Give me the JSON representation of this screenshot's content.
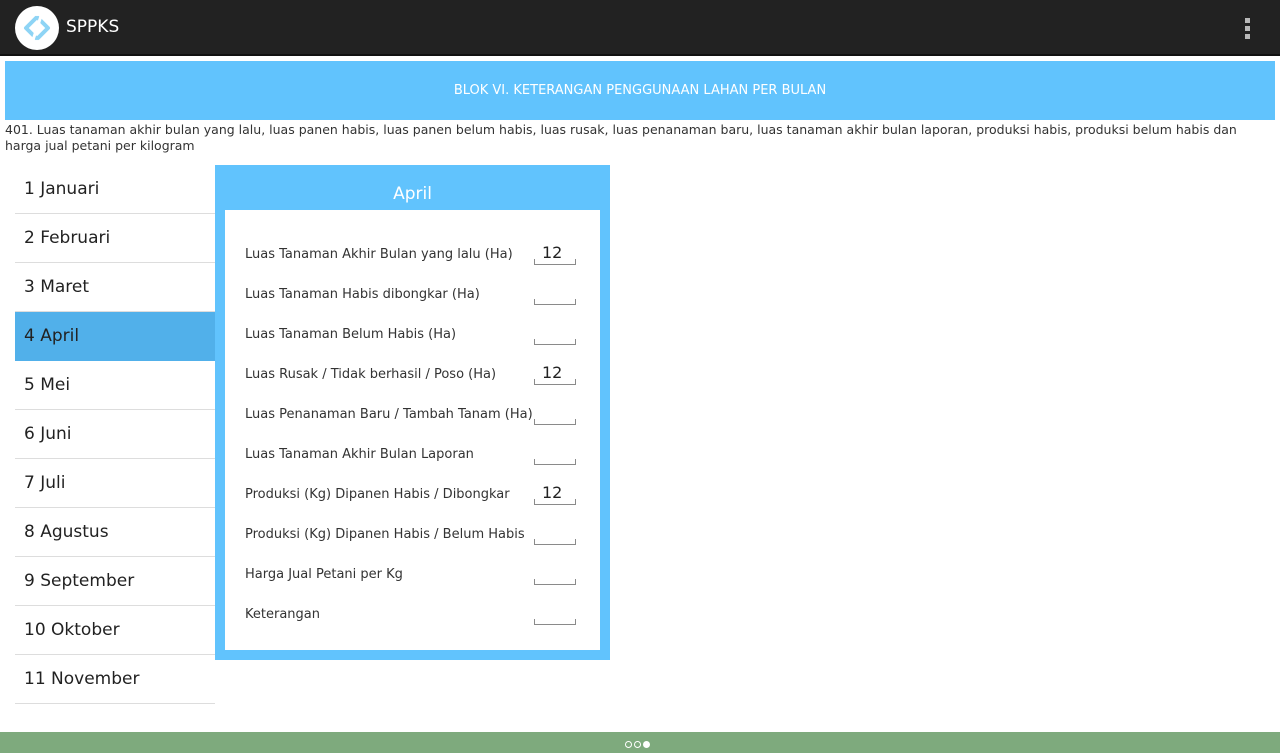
{
  "app": {
    "title": "SPPKS"
  },
  "block": {
    "title": "BLOK VI. KETERANGAN PENGGUNAAN LAHAN PER BULAN",
    "question": "401. Luas tanaman akhir bulan yang lalu, luas panen habis, luas panen belum habis, luas rusak, luas penanaman baru, luas tanaman akhir bulan laporan, produksi habis, produksi belum habis dan harga jual petani per kilogram"
  },
  "months": [
    {
      "label": "1 Januari",
      "selected": false
    },
    {
      "label": "2 Februari",
      "selected": false
    },
    {
      "label": "3 Maret",
      "selected": false
    },
    {
      "label": "4 April",
      "selected": true
    },
    {
      "label": "5 Mei",
      "selected": false
    },
    {
      "label": "6 Juni",
      "selected": false
    },
    {
      "label": "7 Juli",
      "selected": false
    },
    {
      "label": "8 Agustus",
      "selected": false
    },
    {
      "label": "9 September",
      "selected": false
    },
    {
      "label": "10 Oktober",
      "selected": false
    },
    {
      "label": "11 November",
      "selected": false
    }
  ],
  "card": {
    "title": "April",
    "fields": [
      {
        "label": "Luas Tanaman  Akhir Bulan yang lalu (Ha)",
        "value": "12"
      },
      {
        "label": "Luas Tanaman  Habis dibongkar (Ha)",
        "value": ""
      },
      {
        "label": "Luas Tanaman  Belum Habis (Ha)",
        "value": ""
      },
      {
        "label": "Luas Rusak / Tidak berhasil / Poso (Ha)",
        "value": "12"
      },
      {
        "label": "Luas Penanaman Baru / Tambah Tanam (Ha)",
        "value": ""
      },
      {
        "label": "Luas Tanaman Akhir Bulan Laporan",
        "value": ""
      },
      {
        "label": "Produksi (Kg) Dipanen Habis / Dibongkar",
        "value": "12"
      },
      {
        "label": "Produksi (Kg) Dipanen Habis / Belum Habis",
        "value": ""
      },
      {
        "label": "Harga Jual Petani per Kg",
        "value": ""
      },
      {
        "label": "Keterangan",
        "value": ""
      }
    ]
  },
  "pager": {
    "total": 3,
    "active": 3
  },
  "colors": {
    "actionbar": "#222222",
    "accent": "#61c3fd",
    "selected": "#51b0ea",
    "bottombar": "#7eaa7d"
  },
  "icons": {
    "logo": "app-logo-icon",
    "overflow": "overflow-menu-icon"
  }
}
